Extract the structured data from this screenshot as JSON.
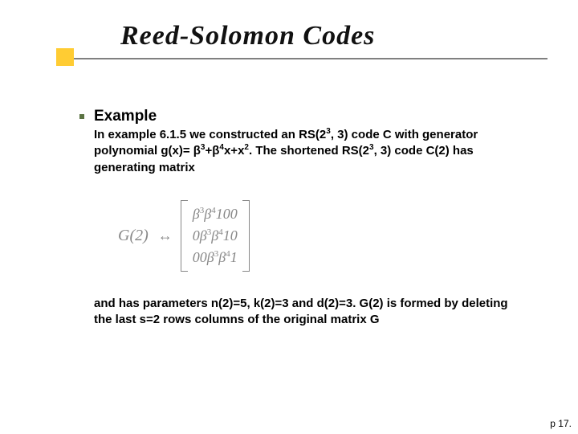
{
  "title": "Reed-Solomon Codes",
  "heading": "Example",
  "para1_pre": "In example 6.1.5 we constructed an RS(2",
  "para1_sup1": "3",
  "para1_mid1": ", 3) code C with generator polynomial g(x)= β",
  "para1_sup2": "3",
  "para1_mid2": "+β",
  "para1_sup3": "4",
  "para1_mid3": "x+x",
  "para1_sup4": "2",
  "para1_mid4": ". The shortened RS(2",
  "para1_sup5": "3",
  "para1_end": ", 3) code C(2) has generating matrix",
  "matrix_label": "G(2)",
  "matrix_arrow": "↔",
  "matrix_row1_a": "β",
  "matrix_row1_a_sup": "3",
  "matrix_row1_b": "β",
  "matrix_row1_b_sup": "4",
  "matrix_row1_rest": "100",
  "matrix_row2_pre": "0",
  "matrix_row2_a": "β",
  "matrix_row2_a_sup": "3",
  "matrix_row2_b": "β",
  "matrix_row2_b_sup": "4",
  "matrix_row2_rest": "10",
  "matrix_row3_pre": "00",
  "matrix_row3_a": "β",
  "matrix_row3_a_sup": "3",
  "matrix_row3_b": "β",
  "matrix_row3_b_sup": "4",
  "matrix_row3_rest": "1",
  "para2": "and has parameters n(2)=5, k(2)=3 and d(2)=3. G(2) is formed by deleting the last s=2 rows columns of the original matrix G",
  "pagenum": "p 17."
}
